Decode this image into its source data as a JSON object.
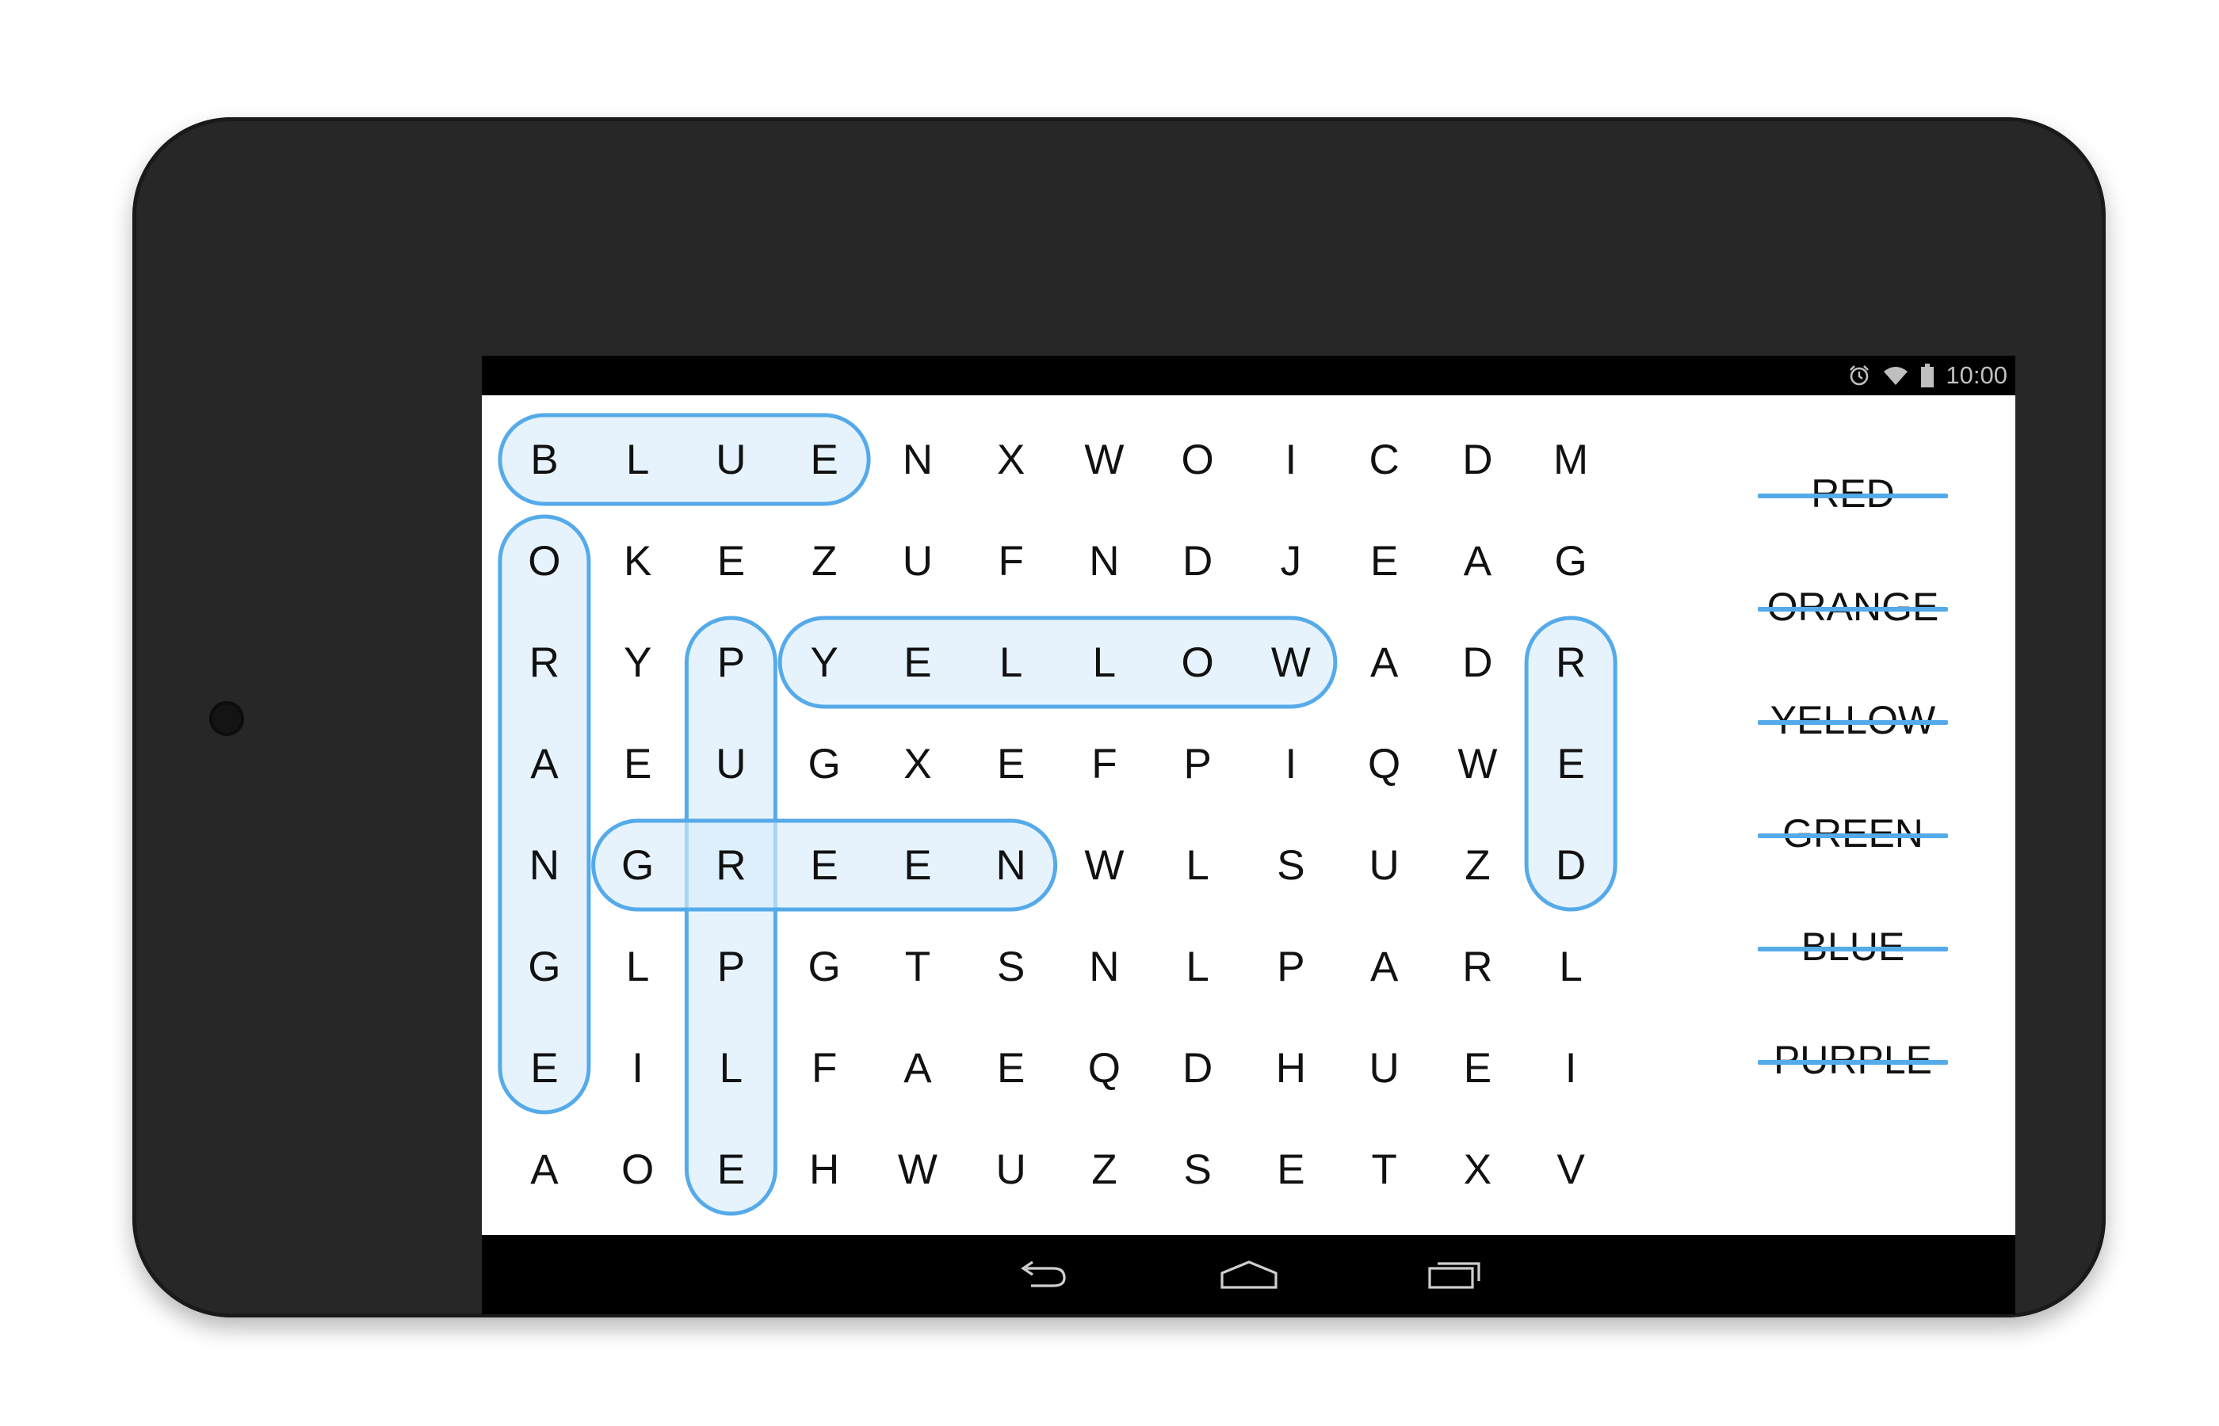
{
  "status_bar": {
    "time": "10:00",
    "icons": [
      "alarm-icon",
      "wifi-icon",
      "battery-icon"
    ]
  },
  "puzzle": {
    "grid": [
      [
        "B",
        "L",
        "U",
        "E",
        "N",
        "X",
        "W",
        "O",
        "I",
        "C",
        "D",
        "M"
      ],
      [
        "O",
        "K",
        "E",
        "Z",
        "U",
        "F",
        "N",
        "D",
        "J",
        "E",
        "A",
        "G"
      ],
      [
        "R",
        "Y",
        "P",
        "Y",
        "E",
        "L",
        "L",
        "O",
        "W",
        "A",
        "D",
        "R"
      ],
      [
        "A",
        "E",
        "U",
        "G",
        "X",
        "E",
        "F",
        "P",
        "I",
        "Q",
        "W",
        "E"
      ],
      [
        "N",
        "G",
        "R",
        "E",
        "E",
        "N",
        "W",
        "L",
        "S",
        "U",
        "Z",
        "D"
      ],
      [
        "G",
        "L",
        "P",
        "G",
        "T",
        "S",
        "N",
        "L",
        "P",
        "A",
        "R",
        "L"
      ],
      [
        "E",
        "I",
        "L",
        "F",
        "A",
        "E",
        "Q",
        "D",
        "H",
        "U",
        "E",
        "I"
      ],
      [
        "A",
        "O",
        "E",
        "H",
        "W",
        "U",
        "Z",
        "S",
        "E",
        "T",
        "X",
        "V"
      ]
    ],
    "found_words": [
      {
        "word": "BLUE",
        "start": [
          0,
          0
        ],
        "end": [
          0,
          3
        ]
      },
      {
        "word": "ORANGE",
        "start": [
          1,
          0
        ],
        "end": [
          6,
          0
        ]
      },
      {
        "word": "PURPLE",
        "start": [
          2,
          2
        ],
        "end": [
          7,
          2
        ]
      },
      {
        "word": "YELLOW",
        "start": [
          2,
          3
        ],
        "end": [
          2,
          8
        ]
      },
      {
        "word": "GREEN",
        "start": [
          4,
          1
        ],
        "end": [
          4,
          5
        ]
      },
      {
        "word": "RED",
        "start": [
          2,
          11
        ],
        "end": [
          4,
          11
        ]
      }
    ],
    "word_list": [
      {
        "label": "RED",
        "found": true
      },
      {
        "label": "ORANGE",
        "found": true
      },
      {
        "label": "YELLOW",
        "found": true
      },
      {
        "label": "GREEN",
        "found": true
      },
      {
        "label": "BLUE",
        "found": true
      },
      {
        "label": "PURPLE",
        "found": true
      }
    ]
  },
  "nav_bar": {
    "buttons": [
      "back-icon",
      "home-icon",
      "recents-icon"
    ]
  },
  "colors": {
    "highlight_stroke": "#55aaea",
    "highlight_fill": "#d9ecfb",
    "device_body": "#272727"
  }
}
